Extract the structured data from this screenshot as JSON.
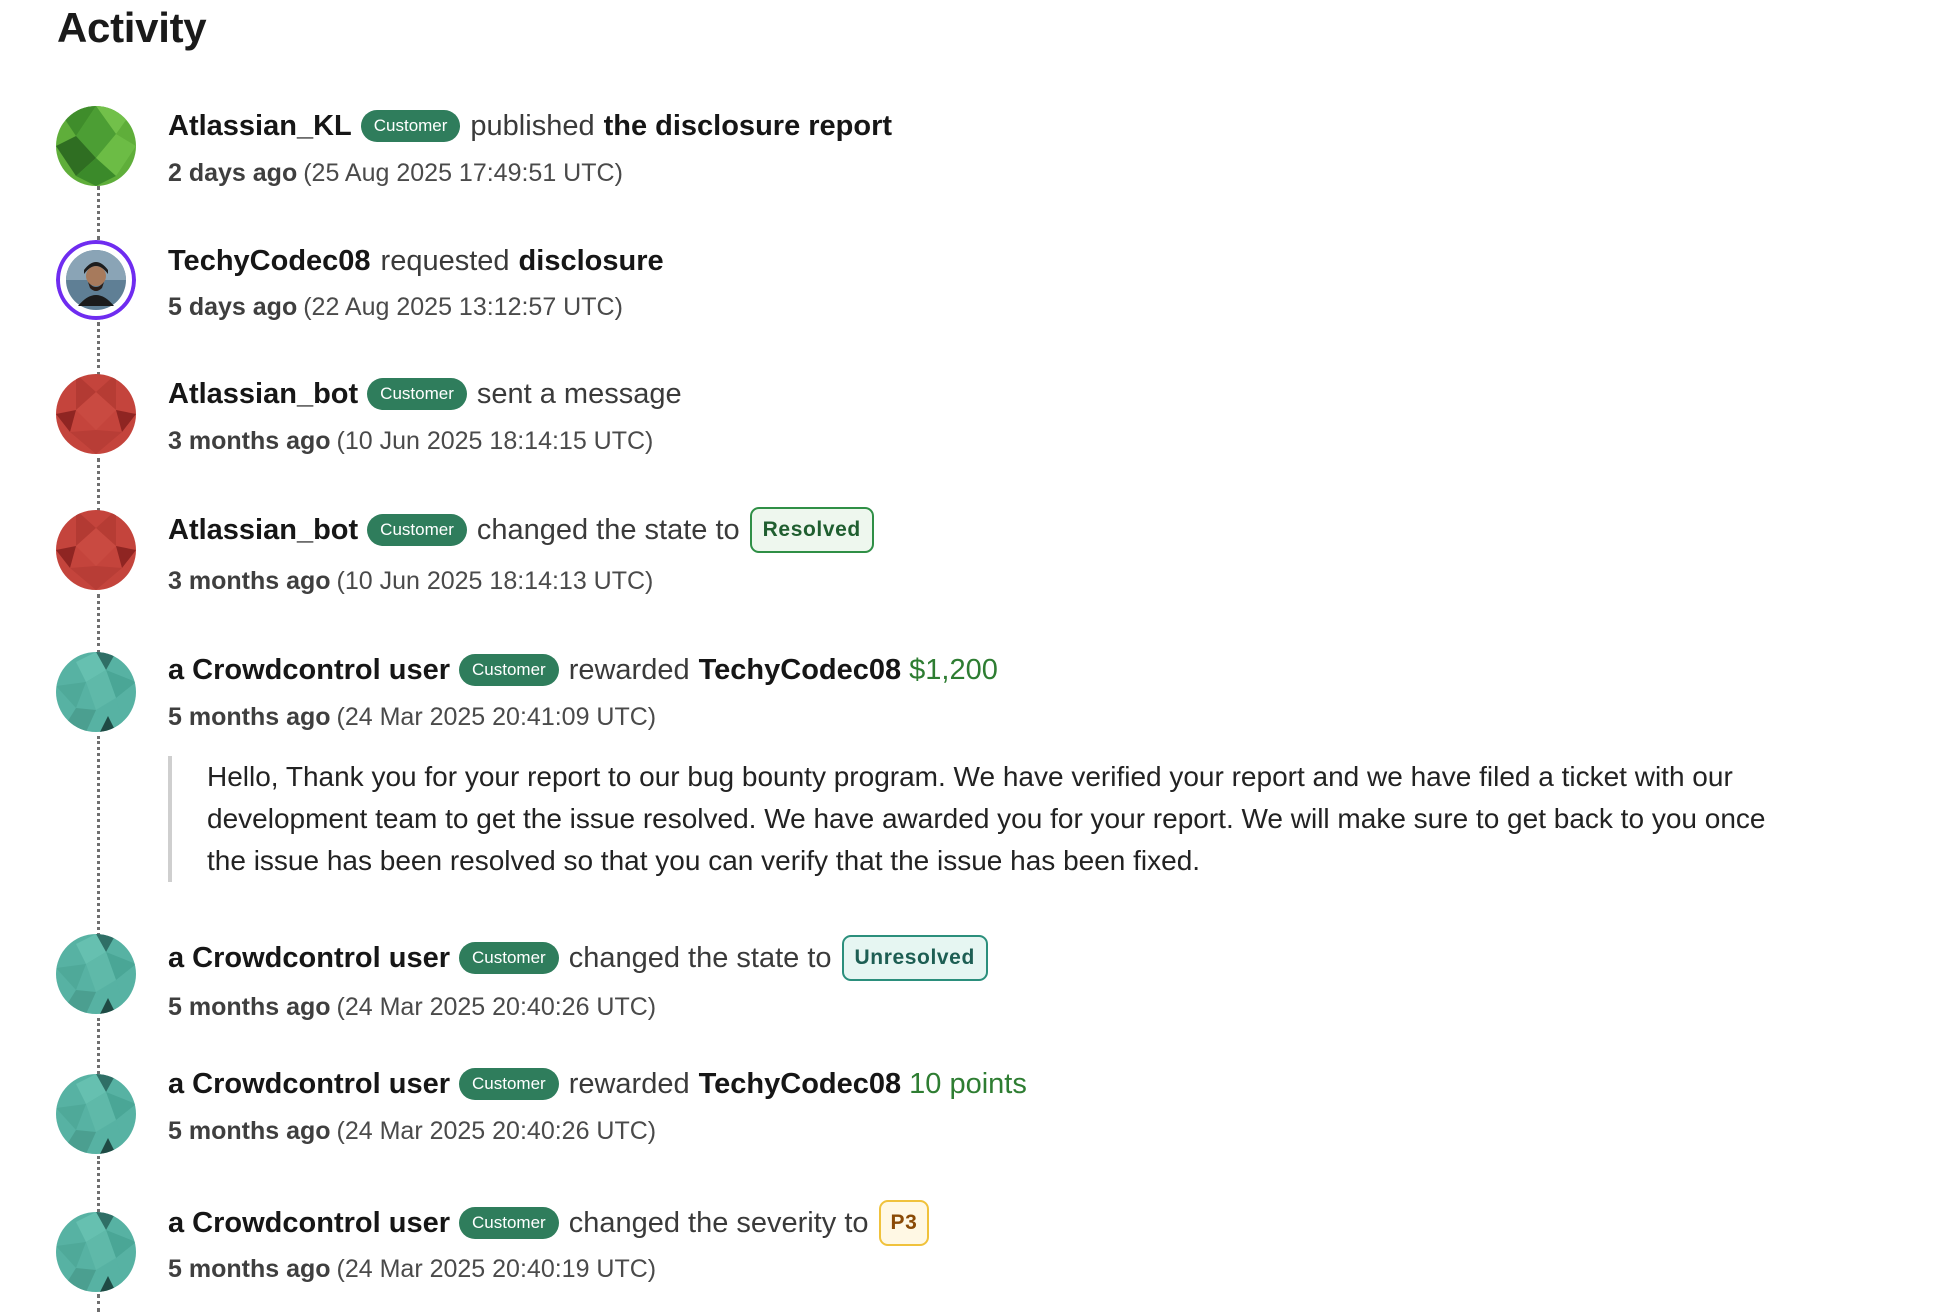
{
  "page": {
    "title": "Activity"
  },
  "colors": {
    "customer_badge": "#2f7d5c",
    "amount_green": "#2e7d32",
    "resolved_border": "#2f8f46",
    "unresolved_border": "#2b8f7c",
    "severity_border": "#f0c23c",
    "avatar_green": "#5fae3a",
    "avatar_red": "#c4443c",
    "avatar_teal": "#57b2a3",
    "avatar_ring_purple": "#6f2cf0"
  },
  "activity": [
    {
      "actor": "Atlassian_KL",
      "badge": "Customer",
      "verb": "published",
      "target": "the disclosure report",
      "relative_time": "2 days ago",
      "absolute_time": "(25 Aug 2025 17:49:51 UTC)",
      "avatar_icon": "green-geometric-avatar-icon"
    },
    {
      "actor": "TechyCodec08",
      "verb": "requested",
      "target": "disclosure",
      "relative_time": "5 days ago",
      "absolute_time": "(22 Aug 2025 13:12:57 UTC)",
      "avatar_icon": "user-photo-avatar-icon"
    },
    {
      "actor": "Atlassian_bot",
      "badge": "Customer",
      "verb": "sent a message",
      "relative_time": "3 months ago",
      "absolute_time": "(10 Jun 2025 18:14:15 UTC)",
      "avatar_icon": "red-geometric-avatar-icon"
    },
    {
      "actor": "Atlassian_bot",
      "badge": "Customer",
      "verb": "changed the state to",
      "state": "Resolved",
      "relative_time": "3 months ago",
      "absolute_time": "(10 Jun 2025 18:14:13 UTC)",
      "avatar_icon": "red-geometric-avatar-icon"
    },
    {
      "actor": "a Crowdcontrol user",
      "badge": "Customer",
      "verb": "rewarded",
      "target": "TechyCodec08",
      "amount": "$1,200",
      "relative_time": "5 months ago",
      "absolute_time": "(24 Mar 2025 20:41:09 UTC)",
      "message": "Hello, Thank you for your report to our bug bounty program. We have verified your report and we have filed a ticket with our development team to get the issue resolved. We have awarded you for your report. We will make sure to get back to you once the issue has been resolved so that you can verify that the issue has been fixed.",
      "avatar_icon": "teal-geometric-avatar-icon"
    },
    {
      "actor": "a Crowdcontrol user",
      "badge": "Customer",
      "verb": "changed the state to",
      "state": "Unresolved",
      "relative_time": "5 months ago",
      "absolute_time": "(24 Mar 2025 20:40:26 UTC)",
      "avatar_icon": "teal-geometric-avatar-icon"
    },
    {
      "actor": "a Crowdcontrol user",
      "badge": "Customer",
      "verb": "rewarded",
      "target": "TechyCodec08",
      "amount": "10 points",
      "relative_time": "5 months ago",
      "absolute_time": "(24 Mar 2025 20:40:26 UTC)",
      "avatar_icon": "teal-geometric-avatar-icon"
    },
    {
      "actor": "a Crowdcontrol user",
      "badge": "Customer",
      "verb": "changed the severity to",
      "severity": "P3",
      "relative_time": "5 months ago",
      "absolute_time": "(24 Mar 2025 20:40:19 UTC)",
      "avatar_icon": "teal-geometric-avatar-icon"
    }
  ]
}
